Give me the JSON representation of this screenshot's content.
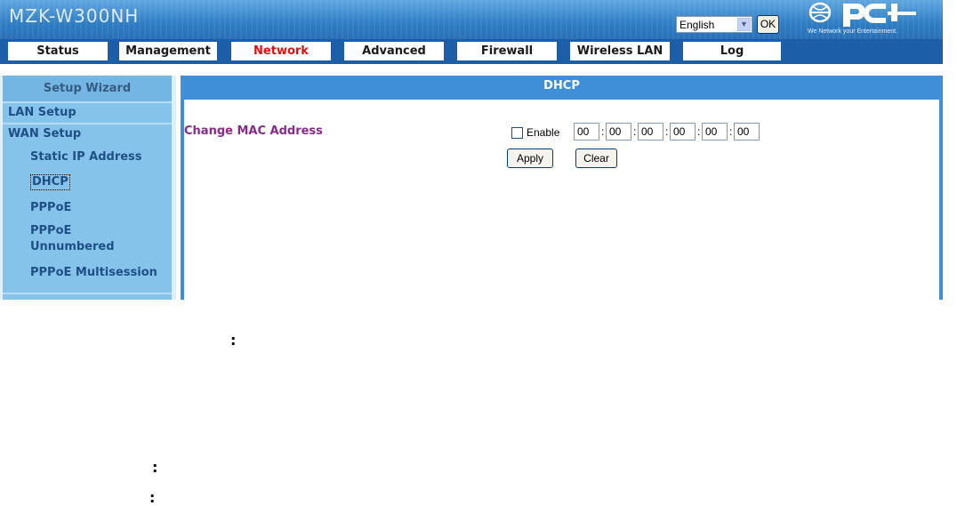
{
  "header": {
    "model": "MZK-W300NH",
    "language": {
      "selected": "English"
    },
    "ok_label": "OK",
    "brand": {
      "name": "PCI",
      "tagline": "We Network your Entertainment."
    }
  },
  "nav": {
    "tabs": [
      {
        "label": "Status"
      },
      {
        "label": "Management"
      },
      {
        "label": "Network",
        "active": true
      },
      {
        "label": "Advanced"
      },
      {
        "label": "Firewall"
      },
      {
        "label": "Wireless LAN"
      },
      {
        "label": "Log"
      }
    ]
  },
  "sidebar": {
    "wizard": "Setup Wizard",
    "lan": "LAN Setup",
    "wan": "WAN Setup",
    "sub": {
      "static": "Static IP Address",
      "dhcp": "DHCP",
      "pppoe": "PPPoE",
      "pppoe_unnumbered_1": "PPPoE",
      "pppoe_unnumbered_2": "Unnumbered",
      "multisession": "PPPoE Multisession"
    }
  },
  "main": {
    "title": "DHCP",
    "mac_label": "Change MAC Address",
    "enable_label": "Enable",
    "enable_checked": false,
    "mac": [
      "00",
      "00",
      "00",
      "00",
      "00",
      "00"
    ],
    "apply_label": "Apply",
    "clear_label": "Clear"
  },
  "below": {
    "colon": ":"
  },
  "colors": {
    "nav_bg": "#1c5fa8",
    "active_tab": "#e01010",
    "sidebar_text": "#1e4f86",
    "content_title_bg": "#3f8fd8",
    "mac_label": "#8a2a8c"
  }
}
